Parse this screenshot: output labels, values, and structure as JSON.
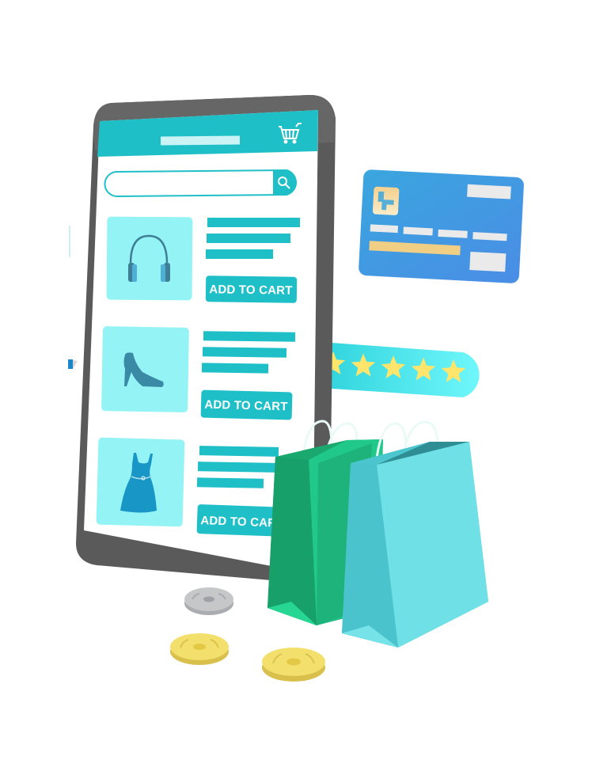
{
  "scene": {
    "title": "Online shopping illustration",
    "background": "#ffffff"
  },
  "phone": {
    "frame_color": "#5a5a5a",
    "header": {
      "color": "#1fbfc8",
      "title_placeholder": "title-bar",
      "cart_icon": "shopping-cart-icon"
    },
    "search": {
      "value": "",
      "placeholder": "",
      "icon": "search-icon",
      "accent": "#1fbfc8"
    },
    "products": [
      {
        "name": "headphones",
        "icon": "headphones-icon",
        "button_label": "ADD TO CART"
      },
      {
        "name": "high-heel-shoe",
        "icon": "high-heel-icon",
        "button_label": "ADD TO CART"
      },
      {
        "name": "dress",
        "icon": "dress-icon",
        "button_label": "ADD TO CART"
      }
    ],
    "thumb_bg": "#93f3f5",
    "button_color": "#1fbfc8"
  },
  "credit_card": {
    "color": "#3f9fe0",
    "chip_icon": "card-chip-icon",
    "stripe_color": "#f0cf85"
  },
  "rating": {
    "stars": 5,
    "max_stars": 5,
    "star_color": "#ffe56b",
    "bar_color": "#4ee7ee"
  },
  "bags": [
    {
      "name": "green-bag",
      "color": "#20c98a"
    },
    {
      "name": "teal-bag",
      "color": "#6fe0e6"
    }
  ],
  "coins": [
    {
      "name": "silver-coin",
      "color": "#c5c7c9"
    },
    {
      "name": "gold-coin",
      "color": "#f3df6b"
    },
    {
      "name": "gold-coin",
      "color": "#f3df6b"
    }
  ]
}
